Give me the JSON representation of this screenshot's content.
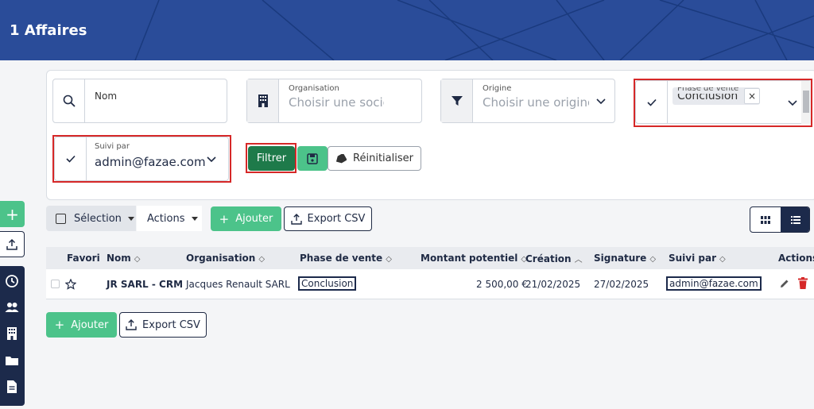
{
  "header": {
    "title": "1 Affaires"
  },
  "filters": {
    "nom": {
      "placeholder": "Nom"
    },
    "organisation": {
      "label": "Organisation",
      "placeholder": "Choisir une socié"
    },
    "origine": {
      "label": "Origine",
      "placeholder": "Choisir une origine"
    },
    "phase": {
      "label": "Phase de vente",
      "chip": "Conclusion",
      "chip_remove": "×"
    },
    "suivi": {
      "label": "Suivi par",
      "value": "admin@fazae.com"
    },
    "btn_filtrer": "Filtrer",
    "btn_reset": "Réinitialiser"
  },
  "toolbar": {
    "selection": "Sélection",
    "actions": "Actions",
    "add": "Ajouter",
    "export": "Export CSV"
  },
  "table": {
    "headers": [
      "Favori",
      "Nom",
      "Organisation",
      "Phase de vente",
      "Montant potentiel",
      "Création",
      "Signature",
      "Suivi par",
      "Actions"
    ],
    "rows": [
      {
        "nom": "JR SARL - CRM",
        "organisation": "Jacques Renault SARL",
        "phase": "Conclusion",
        "montant": "2 500,00 €",
        "creation": "21/02/2025",
        "signature": "27/02/2025",
        "suivi": "admin@fazae.com"
      }
    ]
  },
  "bottom": {
    "add": "Ajouter",
    "export": "Export CSV"
  },
  "colors": {
    "header": "#2a4c99",
    "green": "#4cc38a",
    "dark_green": "#1e7a4a",
    "navy": "#1c2a4b",
    "red": "#d62828"
  }
}
